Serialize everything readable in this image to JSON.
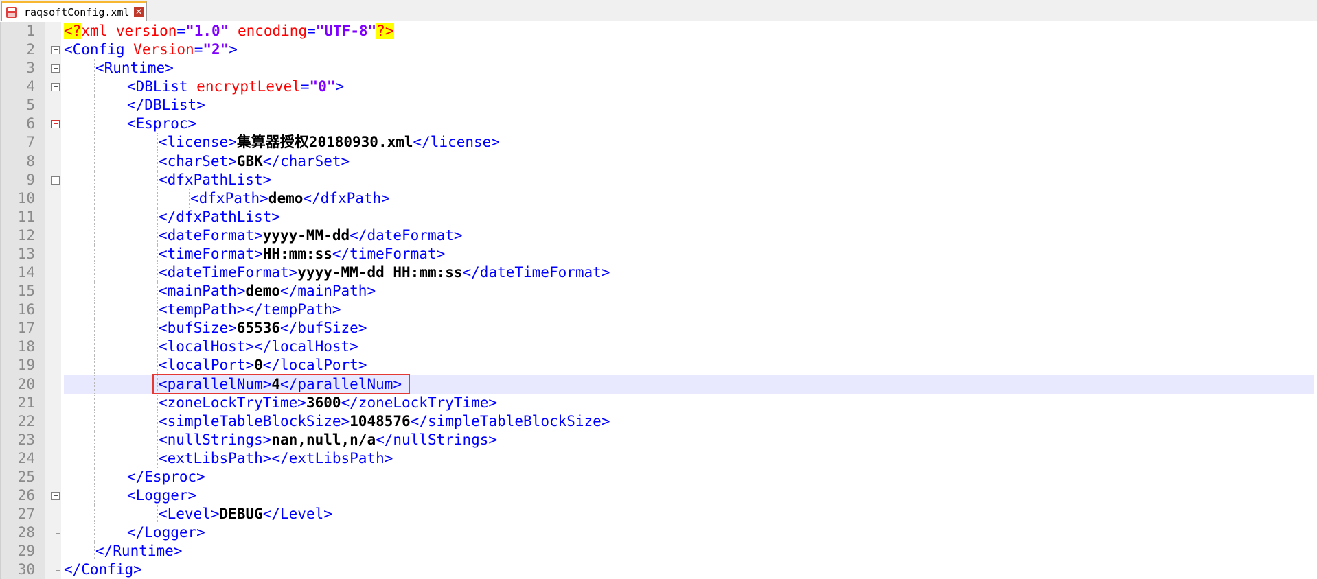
{
  "tab": {
    "filename": "raqsoftConfig.xml",
    "save_icon": "save-icon",
    "close_icon": "close-icon",
    "close_glyph": "✕",
    "accent_color": "#f7b731"
  },
  "editor": {
    "current_line": 20,
    "highlighted_line": 20,
    "colors": {
      "tag": "#0000ff",
      "attribute": "#ff0000",
      "value": "#8000ff",
      "text": "#000000",
      "current_line_bg": "#e8e8ff",
      "highlight_box": "#e53935",
      "fold_active": "#d63031"
    },
    "lines": [
      {
        "n": "1",
        "indent": 0,
        "fold": "",
        "tokens": [
          {
            "t": "decl",
            "v": "<?"
          },
          {
            "t": "xmlname",
            "v": "xml"
          },
          {
            "t": "plain",
            "v": " "
          },
          {
            "t": "attr",
            "v": "version"
          },
          {
            "t": "tag",
            "v": "="
          },
          {
            "t": "val",
            "v": "\"1.0\""
          },
          {
            "t": "plain",
            "v": " "
          },
          {
            "t": "attr",
            "v": "encoding"
          },
          {
            "t": "tag",
            "v": "="
          },
          {
            "t": "val",
            "v": "\"UTF-8\""
          },
          {
            "t": "decl",
            "v": "?>"
          }
        ]
      },
      {
        "n": "2",
        "indent": 0,
        "fold": "box",
        "tokens": [
          {
            "t": "tag",
            "v": "<Config"
          },
          {
            "t": "plain",
            "v": " "
          },
          {
            "t": "attr",
            "v": "Version"
          },
          {
            "t": "tag",
            "v": "="
          },
          {
            "t": "val",
            "v": "\"2\""
          },
          {
            "t": "tag",
            "v": ">"
          }
        ]
      },
      {
        "n": "3",
        "indent": 1,
        "fold": "box",
        "tokens": [
          {
            "t": "tag",
            "v": "<Runtime>"
          }
        ]
      },
      {
        "n": "4",
        "indent": 2,
        "fold": "box",
        "tokens": [
          {
            "t": "tag",
            "v": "<DBList"
          },
          {
            "t": "plain",
            "v": " "
          },
          {
            "t": "attr",
            "v": "encryptLevel"
          },
          {
            "t": "tag",
            "v": "="
          },
          {
            "t": "val",
            "v": "\"0\""
          },
          {
            "t": "tag",
            "v": ">"
          }
        ]
      },
      {
        "n": "5",
        "indent": 2,
        "fold": "end",
        "tokens": [
          {
            "t": "tag",
            "v": "</DBList>"
          }
        ]
      },
      {
        "n": "6",
        "indent": 2,
        "fold": "boxred",
        "tokens": [
          {
            "t": "tag",
            "v": "<Esproc>"
          }
        ]
      },
      {
        "n": "7",
        "indent": 3,
        "fold": "",
        "tokens": [
          {
            "t": "tag",
            "v": "<license>"
          },
          {
            "t": "text",
            "v": "集算器授权20180930.xml"
          },
          {
            "t": "tag",
            "v": "</license>"
          }
        ]
      },
      {
        "n": "8",
        "indent": 3,
        "fold": "",
        "tokens": [
          {
            "t": "tag",
            "v": "<charSet>"
          },
          {
            "t": "text",
            "v": "GBK"
          },
          {
            "t": "tag",
            "v": "</charSet>"
          }
        ]
      },
      {
        "n": "9",
        "indent": 3,
        "fold": "box",
        "tokens": [
          {
            "t": "tag",
            "v": "<dfxPathList>"
          }
        ]
      },
      {
        "n": "10",
        "indent": 4,
        "fold": "",
        "tokens": [
          {
            "t": "tag",
            "v": "<dfxPath>"
          },
          {
            "t": "text",
            "v": "demo"
          },
          {
            "t": "tag",
            "v": "</dfxPath>"
          }
        ]
      },
      {
        "n": "11",
        "indent": 3,
        "fold": "end",
        "tokens": [
          {
            "t": "tag",
            "v": "</dfxPathList>"
          }
        ]
      },
      {
        "n": "12",
        "indent": 3,
        "fold": "",
        "tokens": [
          {
            "t": "tag",
            "v": "<dateFormat>"
          },
          {
            "t": "text",
            "v": "yyyy-MM-dd"
          },
          {
            "t": "tag",
            "v": "</dateFormat>"
          }
        ]
      },
      {
        "n": "13",
        "indent": 3,
        "fold": "",
        "tokens": [
          {
            "t": "tag",
            "v": "<timeFormat>"
          },
          {
            "t": "text",
            "v": "HH:mm:ss"
          },
          {
            "t": "tag",
            "v": "</timeFormat>"
          }
        ]
      },
      {
        "n": "14",
        "indent": 3,
        "fold": "",
        "tokens": [
          {
            "t": "tag",
            "v": "<dateTimeFormat>"
          },
          {
            "t": "text",
            "v": "yyyy-MM-dd HH:mm:ss"
          },
          {
            "t": "tag",
            "v": "</dateTimeFormat>"
          }
        ]
      },
      {
        "n": "15",
        "indent": 3,
        "fold": "",
        "tokens": [
          {
            "t": "tag",
            "v": "<mainPath>"
          },
          {
            "t": "text",
            "v": "demo"
          },
          {
            "t": "tag",
            "v": "</mainPath>"
          }
        ]
      },
      {
        "n": "16",
        "indent": 3,
        "fold": "",
        "tokens": [
          {
            "t": "tag",
            "v": "<tempPath></tempPath>"
          }
        ]
      },
      {
        "n": "17",
        "indent": 3,
        "fold": "",
        "tokens": [
          {
            "t": "tag",
            "v": "<bufSize>"
          },
          {
            "t": "text",
            "v": "65536"
          },
          {
            "t": "tag",
            "v": "</bufSize>"
          }
        ]
      },
      {
        "n": "18",
        "indent": 3,
        "fold": "",
        "tokens": [
          {
            "t": "tag",
            "v": "<localHost></localHost>"
          }
        ]
      },
      {
        "n": "19",
        "indent": 3,
        "fold": "",
        "tokens": [
          {
            "t": "tag",
            "v": "<localPort>"
          },
          {
            "t": "text",
            "v": "0"
          },
          {
            "t": "tag",
            "v": "</localPort>"
          }
        ]
      },
      {
        "n": "20",
        "indent": 3,
        "fold": "",
        "tokens": [
          {
            "t": "tag",
            "v": "<parallelNum>"
          },
          {
            "t": "text",
            "v": "4"
          },
          {
            "t": "tag",
            "v": "</parallelNum>"
          }
        ]
      },
      {
        "n": "21",
        "indent": 3,
        "fold": "",
        "tokens": [
          {
            "t": "tag",
            "v": "<zoneLockTryTime>"
          },
          {
            "t": "text",
            "v": "3600"
          },
          {
            "t": "tag",
            "v": "</zoneLockTryTime>"
          }
        ]
      },
      {
        "n": "22",
        "indent": 3,
        "fold": "",
        "tokens": [
          {
            "t": "tag",
            "v": "<simpleTableBlockSize>"
          },
          {
            "t": "text",
            "v": "1048576"
          },
          {
            "t": "tag",
            "v": "</simpleTableBlockSize>"
          }
        ]
      },
      {
        "n": "23",
        "indent": 3,
        "fold": "",
        "tokens": [
          {
            "t": "tag",
            "v": "<nullStrings>"
          },
          {
            "t": "text",
            "v": "nan,null,n/a"
          },
          {
            "t": "tag",
            "v": "</nullStrings>"
          }
        ]
      },
      {
        "n": "24",
        "indent": 3,
        "fold": "",
        "tokens": [
          {
            "t": "tag",
            "v": "<extLibsPath></extLibsPath>"
          }
        ]
      },
      {
        "n": "25",
        "indent": 2,
        "fold": "endred",
        "tokens": [
          {
            "t": "tag",
            "v": "</Esproc>"
          }
        ]
      },
      {
        "n": "26",
        "indent": 2,
        "fold": "box",
        "tokens": [
          {
            "t": "tag",
            "v": "<Logger>"
          }
        ]
      },
      {
        "n": "27",
        "indent": 3,
        "fold": "",
        "tokens": [
          {
            "t": "tag",
            "v": "<Level>"
          },
          {
            "t": "text",
            "v": "DEBUG"
          },
          {
            "t": "tag",
            "v": "</Level>"
          }
        ]
      },
      {
        "n": "28",
        "indent": 2,
        "fold": "end",
        "tokens": [
          {
            "t": "tag",
            "v": "</Logger>"
          }
        ]
      },
      {
        "n": "29",
        "indent": 1,
        "fold": "end",
        "tokens": [
          {
            "t": "tag",
            "v": "</Runtime>"
          }
        ]
      },
      {
        "n": "30",
        "indent": 0,
        "fold": "end",
        "tokens": [
          {
            "t": "tag",
            "v": "</Config>"
          }
        ]
      }
    ]
  }
}
